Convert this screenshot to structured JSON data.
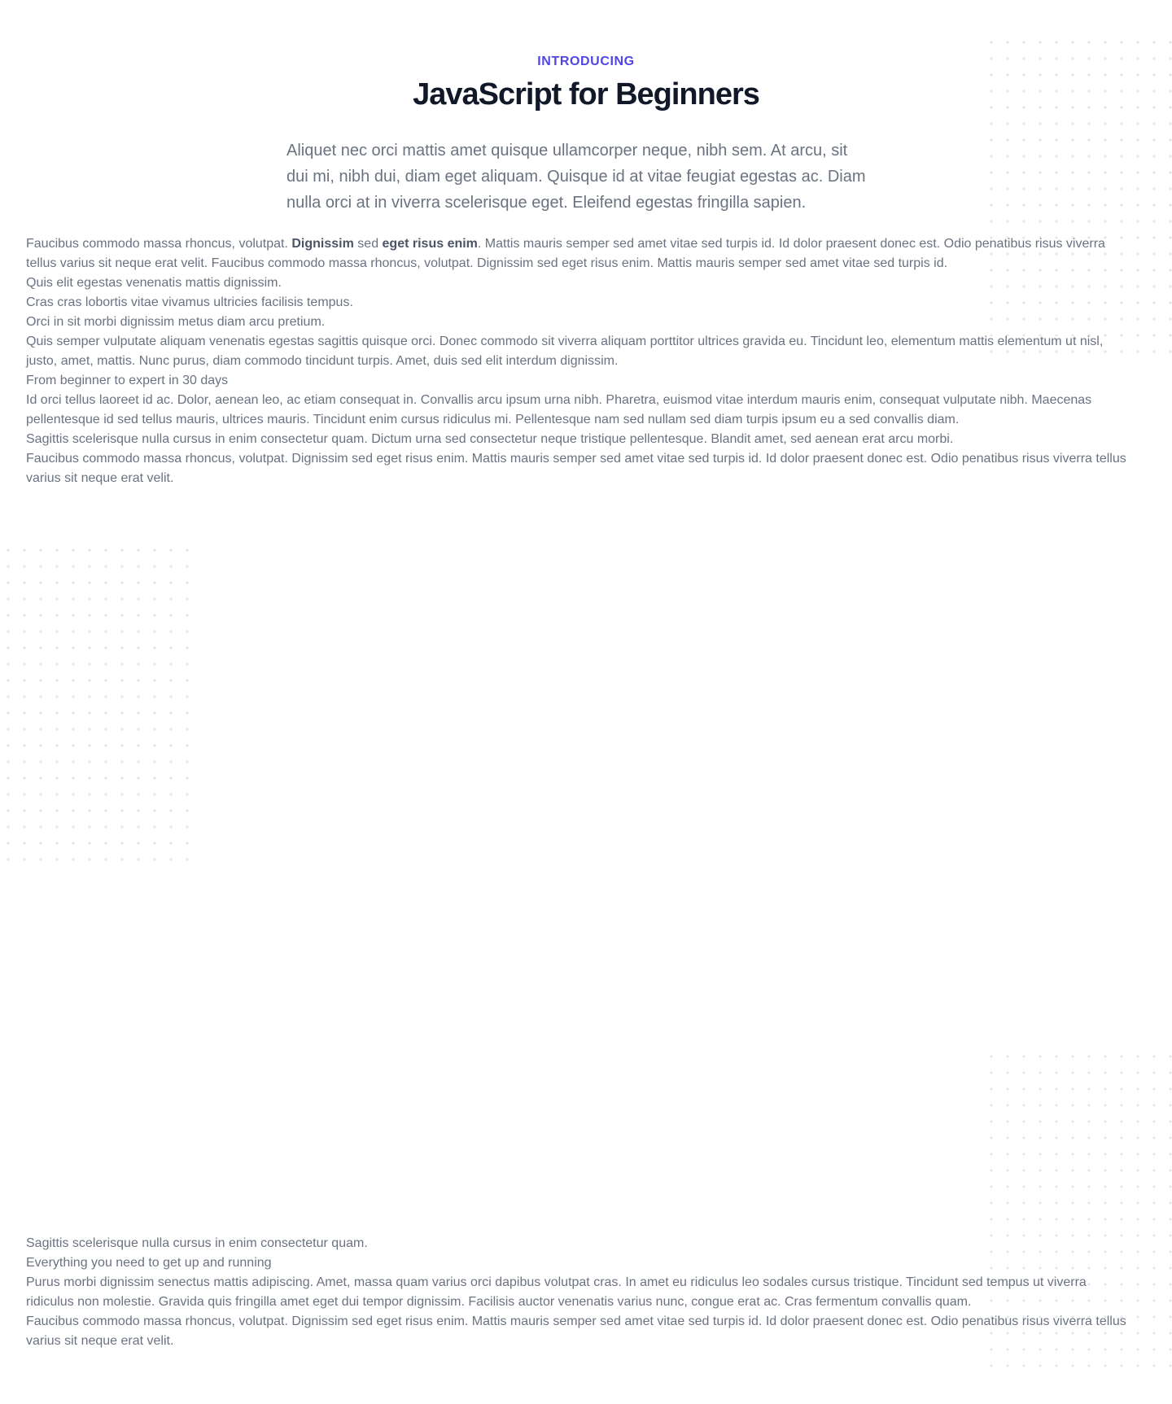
{
  "header": {
    "eyebrow": "INTRODUCING",
    "title": "JavaScript for Beginners",
    "lead": "Aliquet nec orci mattis amet quisque ullamcorper neque, nibh sem. At arcu, sit dui mi, nibh dui, diam eget aliquam. Quisque id at vitae feugiat egestas ac. Diam nulla orci at in viverra scelerisque eget. Eleifend egestas fringilla sapien."
  },
  "body_top": {
    "p1": {
      "t1": "Faucibus commodo massa rhoncus, volutpat. ",
      "b1": "Dignissim",
      "t2": " sed ",
      "b2": "eget risus enim",
      "t3": ". Mattis mauris semper sed amet vitae sed turpis id. Id dolor praesent donec est. Odio penatibus risus viverra tellus varius sit neque erat velit. Faucibus commodo massa rhoncus, volutpat. Dignissim sed eget risus enim. Mattis mauris semper sed amet vitae sed turpis id."
    },
    "lines": [
      "Quis elit egestas venenatis mattis dignissim.",
      "Cras cras lobortis vitae vivamus ultricies facilisis tempus.",
      "Orci in sit morbi dignissim metus diam arcu pretium.",
      "Quis semper vulputate aliquam venenatis egestas sagittis quisque orci. Donec commodo sit viverra aliquam porttitor ultrices gravida eu. Tincidunt leo, elementum mattis elementum ut nisl, justo, amet, mattis. Nunc purus, diam commodo tincidunt turpis. Amet, duis sed elit interdum dignissim.",
      "From beginner to expert in 30 days",
      "Id orci tellus laoreet id ac. Dolor, aenean leo, ac etiam consequat in. Convallis arcu ipsum urna nibh. Pharetra, euismod vitae interdum mauris enim, consequat vulputate nibh. Maecenas pellentesque id sed tellus mauris, ultrices mauris. Tincidunt enim cursus ridiculus mi. Pellentesque nam sed nullam sed diam turpis ipsum eu a sed convallis diam.",
      "Sagittis scelerisque nulla cursus in enim consectetur quam. Dictum urna sed consectetur neque tristique pellentesque. Blandit amet, sed aenean erat arcu morbi.",
      "Faucibus commodo massa rhoncus, volutpat. Dignissim sed eget risus enim. Mattis mauris semper sed amet vitae sed turpis id. Id dolor praesent donec est. Odio penatibus risus viverra tellus varius sit neque erat velit."
    ]
  },
  "body_bottom": {
    "lines": [
      "Sagittis scelerisque nulla cursus in enim consectetur quam.",
      "Everything you need to get up and running",
      "Purus morbi dignissim senectus mattis adipiscing. Amet, massa quam varius orci dapibus volutpat cras. In amet eu ridiculus leo sodales cursus tristique. Tincidunt sed tempus ut viverra ridiculus non molestie. Gravida quis fringilla amet eget dui tempor dignissim. Facilisis auctor venenatis varius nunc, congue erat ac. Cras fermentum convallis quam.",
      "Faucibus commodo massa rhoncus, volutpat. Dignissim sed eget risus enim. Mattis mauris semper sed amet vitae sed turpis id. Id dolor praesent donec est. Odio penatibus risus viverra tellus varius sit neque erat velit."
    ]
  },
  "colors": {
    "accent": "#4f46e5",
    "heading": "#111827",
    "body": "#6b7280",
    "dots": "#e5e7eb"
  }
}
